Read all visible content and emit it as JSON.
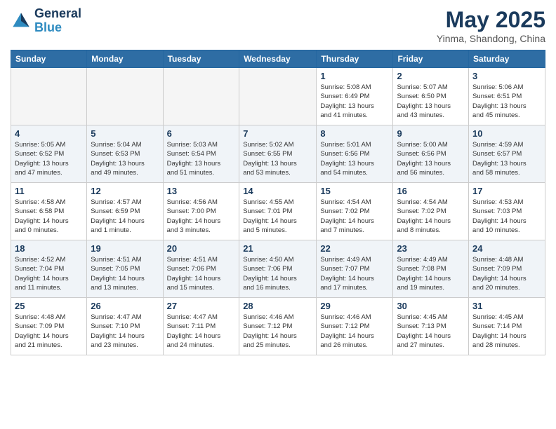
{
  "header": {
    "logo_line1": "General",
    "logo_line2": "Blue",
    "month": "May 2025",
    "location": "Yinma, Shandong, China"
  },
  "weekdays": [
    "Sunday",
    "Monday",
    "Tuesday",
    "Wednesday",
    "Thursday",
    "Friday",
    "Saturday"
  ],
  "weeks": [
    [
      {
        "day": "",
        "info": ""
      },
      {
        "day": "",
        "info": ""
      },
      {
        "day": "",
        "info": ""
      },
      {
        "day": "",
        "info": ""
      },
      {
        "day": "1",
        "info": "Sunrise: 5:08 AM\nSunset: 6:49 PM\nDaylight: 13 hours\nand 41 minutes."
      },
      {
        "day": "2",
        "info": "Sunrise: 5:07 AM\nSunset: 6:50 PM\nDaylight: 13 hours\nand 43 minutes."
      },
      {
        "day": "3",
        "info": "Sunrise: 5:06 AM\nSunset: 6:51 PM\nDaylight: 13 hours\nand 45 minutes."
      }
    ],
    [
      {
        "day": "4",
        "info": "Sunrise: 5:05 AM\nSunset: 6:52 PM\nDaylight: 13 hours\nand 47 minutes."
      },
      {
        "day": "5",
        "info": "Sunrise: 5:04 AM\nSunset: 6:53 PM\nDaylight: 13 hours\nand 49 minutes."
      },
      {
        "day": "6",
        "info": "Sunrise: 5:03 AM\nSunset: 6:54 PM\nDaylight: 13 hours\nand 51 minutes."
      },
      {
        "day": "7",
        "info": "Sunrise: 5:02 AM\nSunset: 6:55 PM\nDaylight: 13 hours\nand 53 minutes."
      },
      {
        "day": "8",
        "info": "Sunrise: 5:01 AM\nSunset: 6:56 PM\nDaylight: 13 hours\nand 54 minutes."
      },
      {
        "day": "9",
        "info": "Sunrise: 5:00 AM\nSunset: 6:56 PM\nDaylight: 13 hours\nand 56 minutes."
      },
      {
        "day": "10",
        "info": "Sunrise: 4:59 AM\nSunset: 6:57 PM\nDaylight: 13 hours\nand 58 minutes."
      }
    ],
    [
      {
        "day": "11",
        "info": "Sunrise: 4:58 AM\nSunset: 6:58 PM\nDaylight: 14 hours\nand 0 minutes."
      },
      {
        "day": "12",
        "info": "Sunrise: 4:57 AM\nSunset: 6:59 PM\nDaylight: 14 hours\nand 1 minute."
      },
      {
        "day": "13",
        "info": "Sunrise: 4:56 AM\nSunset: 7:00 PM\nDaylight: 14 hours\nand 3 minutes."
      },
      {
        "day": "14",
        "info": "Sunrise: 4:55 AM\nSunset: 7:01 PM\nDaylight: 14 hours\nand 5 minutes."
      },
      {
        "day": "15",
        "info": "Sunrise: 4:54 AM\nSunset: 7:02 PM\nDaylight: 14 hours\nand 7 minutes."
      },
      {
        "day": "16",
        "info": "Sunrise: 4:54 AM\nSunset: 7:02 PM\nDaylight: 14 hours\nand 8 minutes."
      },
      {
        "day": "17",
        "info": "Sunrise: 4:53 AM\nSunset: 7:03 PM\nDaylight: 14 hours\nand 10 minutes."
      }
    ],
    [
      {
        "day": "18",
        "info": "Sunrise: 4:52 AM\nSunset: 7:04 PM\nDaylight: 14 hours\nand 11 minutes."
      },
      {
        "day": "19",
        "info": "Sunrise: 4:51 AM\nSunset: 7:05 PM\nDaylight: 14 hours\nand 13 minutes."
      },
      {
        "day": "20",
        "info": "Sunrise: 4:51 AM\nSunset: 7:06 PM\nDaylight: 14 hours\nand 15 minutes."
      },
      {
        "day": "21",
        "info": "Sunrise: 4:50 AM\nSunset: 7:06 PM\nDaylight: 14 hours\nand 16 minutes."
      },
      {
        "day": "22",
        "info": "Sunrise: 4:49 AM\nSunset: 7:07 PM\nDaylight: 14 hours\nand 17 minutes."
      },
      {
        "day": "23",
        "info": "Sunrise: 4:49 AM\nSunset: 7:08 PM\nDaylight: 14 hours\nand 19 minutes."
      },
      {
        "day": "24",
        "info": "Sunrise: 4:48 AM\nSunset: 7:09 PM\nDaylight: 14 hours\nand 20 minutes."
      }
    ],
    [
      {
        "day": "25",
        "info": "Sunrise: 4:48 AM\nSunset: 7:09 PM\nDaylight: 14 hours\nand 21 minutes."
      },
      {
        "day": "26",
        "info": "Sunrise: 4:47 AM\nSunset: 7:10 PM\nDaylight: 14 hours\nand 23 minutes."
      },
      {
        "day": "27",
        "info": "Sunrise: 4:47 AM\nSunset: 7:11 PM\nDaylight: 14 hours\nand 24 minutes."
      },
      {
        "day": "28",
        "info": "Sunrise: 4:46 AM\nSunset: 7:12 PM\nDaylight: 14 hours\nand 25 minutes."
      },
      {
        "day": "29",
        "info": "Sunrise: 4:46 AM\nSunset: 7:12 PM\nDaylight: 14 hours\nand 26 minutes."
      },
      {
        "day": "30",
        "info": "Sunrise: 4:45 AM\nSunset: 7:13 PM\nDaylight: 14 hours\nand 27 minutes."
      },
      {
        "day": "31",
        "info": "Sunrise: 4:45 AM\nSunset: 7:14 PM\nDaylight: 14 hours\nand 28 minutes."
      }
    ]
  ]
}
